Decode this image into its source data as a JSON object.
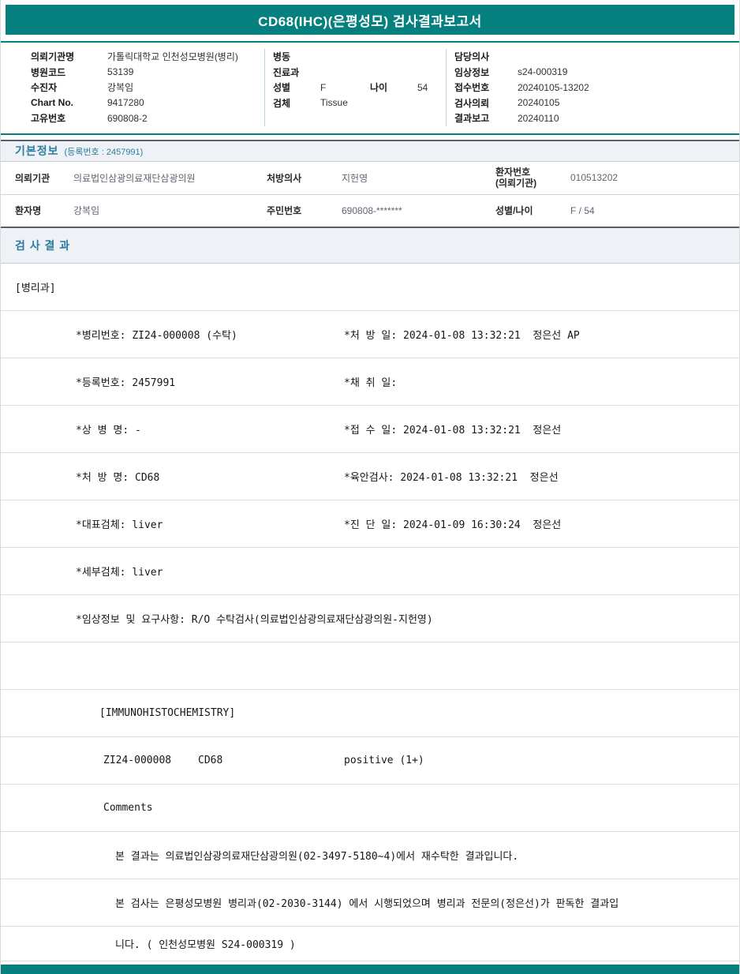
{
  "colors": {
    "teal_bar": "#06807f",
    "section_bg": "#eef1f6",
    "section_title_text": "#2e7ca0"
  },
  "title": "CD68(IHC)(은평성모) 검사결과보고서",
  "header": {
    "col1": [
      {
        "label": "의뢰기관명",
        "value": "가톨릭대학교 인천성모병원(병리)"
      },
      {
        "label": "병원코드",
        "value": "53139"
      },
      {
        "label": "수진자",
        "value": "강복임"
      },
      {
        "label": "Chart No.",
        "value": "9417280"
      },
      {
        "label": "고유번호",
        "value": "690808-2"
      }
    ],
    "col2": {
      "row0": {
        "label": "병동",
        "value": ""
      },
      "row1": {
        "label": "진료과",
        "value": ""
      },
      "row2": {
        "label": "성별",
        "value": "F",
        "label2": "나이",
        "value2": "54"
      },
      "row3": {
        "label": "검체",
        "value": "Tissue"
      }
    },
    "col3": [
      {
        "label": "담당의사",
        "value": ""
      },
      {
        "label": "임상정보",
        "value": "s24-000319"
      },
      {
        "label": "접수번호",
        "value": "20240105-13202"
      },
      {
        "label": "검사의뢰",
        "value": "20240105"
      },
      {
        "label": "결과보고",
        "value": "20240110"
      }
    ]
  },
  "basic_info": {
    "section_title": "기본정보",
    "section_note": "(등록번호 : 2457991)",
    "row1": {
      "c1_label": "의뢰기관",
      "c1_value": "의료법인삼광의료재단삼광의원",
      "c2_label": "처방의사",
      "c2_value": "지헌영",
      "c3_label_line1": "환자번호",
      "c3_label_line2": "(의뢰기관)",
      "c3_value": "010513202"
    },
    "row2": {
      "c1_label": "환자명",
      "c1_value": "강복임",
      "c2_label": "주민번호",
      "c2_value": "690808-*******",
      "c3_label": "성별/나이",
      "c3_value": "F / 54"
    }
  },
  "results": {
    "section_title": "검 사 결 과",
    "department": "[병리과]",
    "detail_rows": [
      {
        "left": "*병리번호: ZI24-000008 (수탁)",
        "right": "*처 방 일: 2024-01-08 13:32:21  정은선 AP"
      },
      {
        "left": "*등록번호: 2457991",
        "right": "*채 취 일:"
      },
      {
        "left": "*상 병 명: -",
        "right": "*접 수 일: 2024-01-08 13:32:21  정은선"
      },
      {
        "left": "*처 방 명: CD68",
        "right": "*육안검사: 2024-01-08 13:32:21  정은선"
      },
      {
        "left": "*대표검체: liver",
        "right": "*진 단 일: 2024-01-09 16:30:24  정은선"
      },
      {
        "left": "*세부검체: liver",
        "right": ""
      }
    ],
    "clinical_info": "*임상정보 및 요구사항: R/O 수탁검사(의료법인삼광의료재단삼광의원-지헌영)",
    "ihc_header": "[IMMUNOHISTOCHEMISTRY]",
    "ihc_row": {
      "code": "ZI24-000008",
      "test": "CD68",
      "result": "positive (1+)"
    },
    "comments_label": "Comments",
    "comment_lines": [
      "본 결과는 의료법인삼광의료재단삼광의원(02-3497-5180~4)에서 재수탁한 결과입니다.",
      "본 검사는 은평성모병원 병리과(02-2030-3144) 에서 시행되었으며 병리과 전문의(정은선)가 판독한 결과입",
      "니다. ( 인천성모병원 S24-000319 )"
    ]
  }
}
